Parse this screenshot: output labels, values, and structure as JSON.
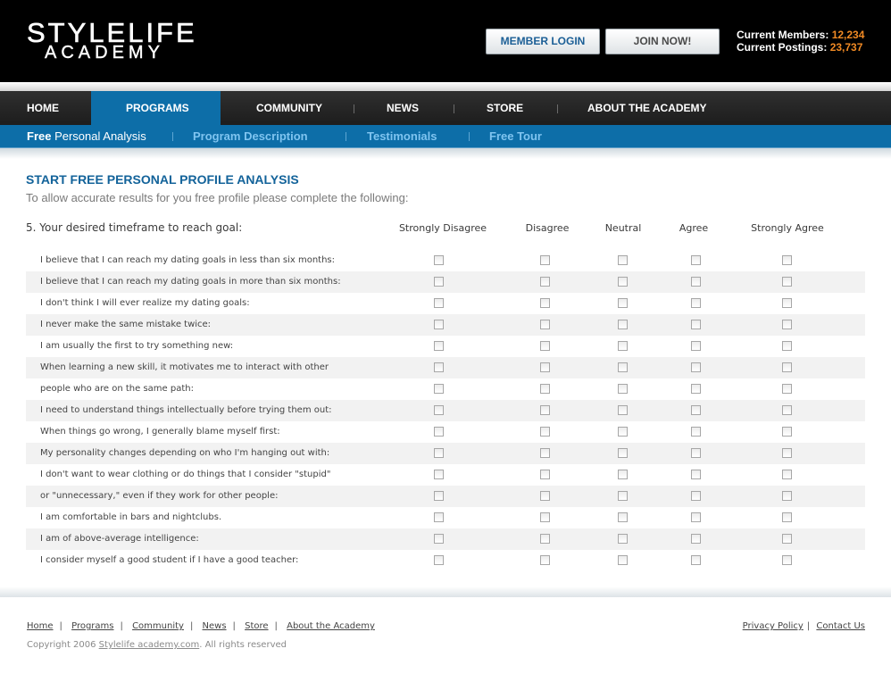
{
  "header": {
    "logo_line1": "STYLELIFE",
    "logo_line2": "ACADEMY",
    "login_label": "MEMBER  LOGIN",
    "join_label": "JOIN NOW!",
    "members_label": "Current Members:",
    "members_value": "12,234",
    "postings_label": "Current Postings:",
    "postings_value": "23,737"
  },
  "nav": {
    "items": [
      {
        "label": "HOME"
      },
      {
        "label": "PROGRAMS",
        "active": true
      },
      {
        "label": "COMMUNITY"
      },
      {
        "label": "NEWS"
      },
      {
        "label": "STORE"
      },
      {
        "label": "ABOUT THE ACADEMY"
      }
    ]
  },
  "subnav": {
    "items": [
      {
        "label_bold": "Free",
        "label_rest": " Personal Analysis",
        "active": true
      },
      {
        "label": "Program Description"
      },
      {
        "label": "Testimonials"
      },
      {
        "label": "Free Tour"
      }
    ]
  },
  "content": {
    "title": "START FREE PERSONAL PROFILE ANALYSIS",
    "subtitle": "To allow accurate results for you free profile please complete the following:",
    "question": "5. Your desired timeframe to reach goal:",
    "columns": [
      "Strongly Disagree",
      "Disagree",
      "Neutral",
      "Agree",
      "Strongly Agree"
    ],
    "statements": [
      "I believe that I can reach my dating goals in less than six months:",
      "I believe that I can reach my dating goals in more than six months:",
      "I don't think I will ever realize my dating goals:",
      "I never make the same mistake twice:",
      "I am usually the first to try something new:",
      "When learning a new skill, it motivates me to interact with other",
      "people who are on the same path:",
      "I need to understand things intellectually before trying them out:",
      "When things go wrong, I generally blame myself first:",
      "My personality changes depending on who I'm hanging out with:",
      "I don't want to wear clothing or do things that I consider \"stupid\"",
      "or \"unnecessary,\" even if they work for other people:",
      "I am comfortable in bars and nightclubs.",
      "I am of above-average intelligence:",
      "I consider myself a good student if I have a good teacher:"
    ]
  },
  "footer": {
    "links": [
      "Home",
      "Programs",
      "Community",
      "News",
      "Store",
      "About the Academy"
    ],
    "right_links": [
      "Privacy Policy",
      "Contact Us"
    ],
    "copyright_prefix": "Copyright 2006 ",
    "copyright_site": "Stylelife academy.com",
    "copyright_suffix": ".  All rights reserved"
  },
  "colors": {
    "accent_blue": "#0d6ea8",
    "title_blue": "#13639a",
    "stat_orange": "#f08a24"
  }
}
